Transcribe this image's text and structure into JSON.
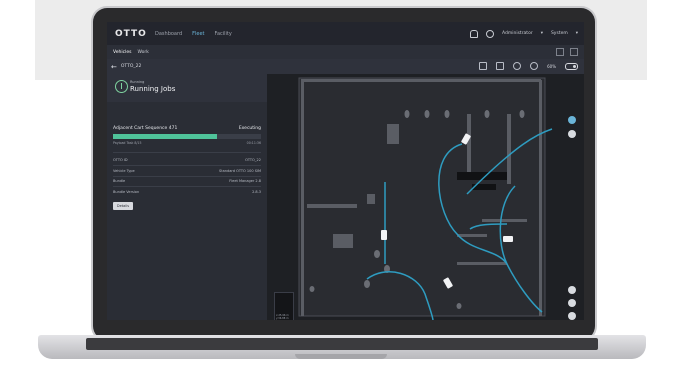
{
  "app": {
    "logo": "OTTO",
    "nav": [
      "Dashboard",
      "Fleet",
      "Facility"
    ],
    "active_nav": "Fleet",
    "user": "Administrator",
    "system": "System"
  },
  "subnav": {
    "tabs": [
      "Vehicles",
      "Work"
    ],
    "active": "Vehicles"
  },
  "breadcrumb": {
    "vehicle": "OTTO_22"
  },
  "toolbar": {
    "battery_pct": "60%"
  },
  "panel": {
    "status_small": "Running",
    "status_big": "Running Jobs",
    "job_name": "Adjacent Cart Sequence 471",
    "job_state": "Executing",
    "progress": 0.7,
    "sub_left": "Payload Task 8/15",
    "sub_right": "00:11:36",
    "info": [
      {
        "label": "OTTO ID",
        "value": "OTTO_22"
      },
      {
        "label": "Vehicle Type",
        "value": "Standard OTTO 100 SIM"
      },
      {
        "label": "Bundle",
        "value": "Fleet Manager 2.8"
      },
      {
        "label": "Bundle Version",
        "value": "2.8.3"
      }
    ],
    "details_label": "Details"
  },
  "minimap": {
    "line1": "x:25.96 m",
    "line2": "y:36.88 m"
  },
  "colors": {
    "accent": "#6ab4d8",
    "progress": "#4fc39a",
    "path": "#2e9cc0"
  }
}
